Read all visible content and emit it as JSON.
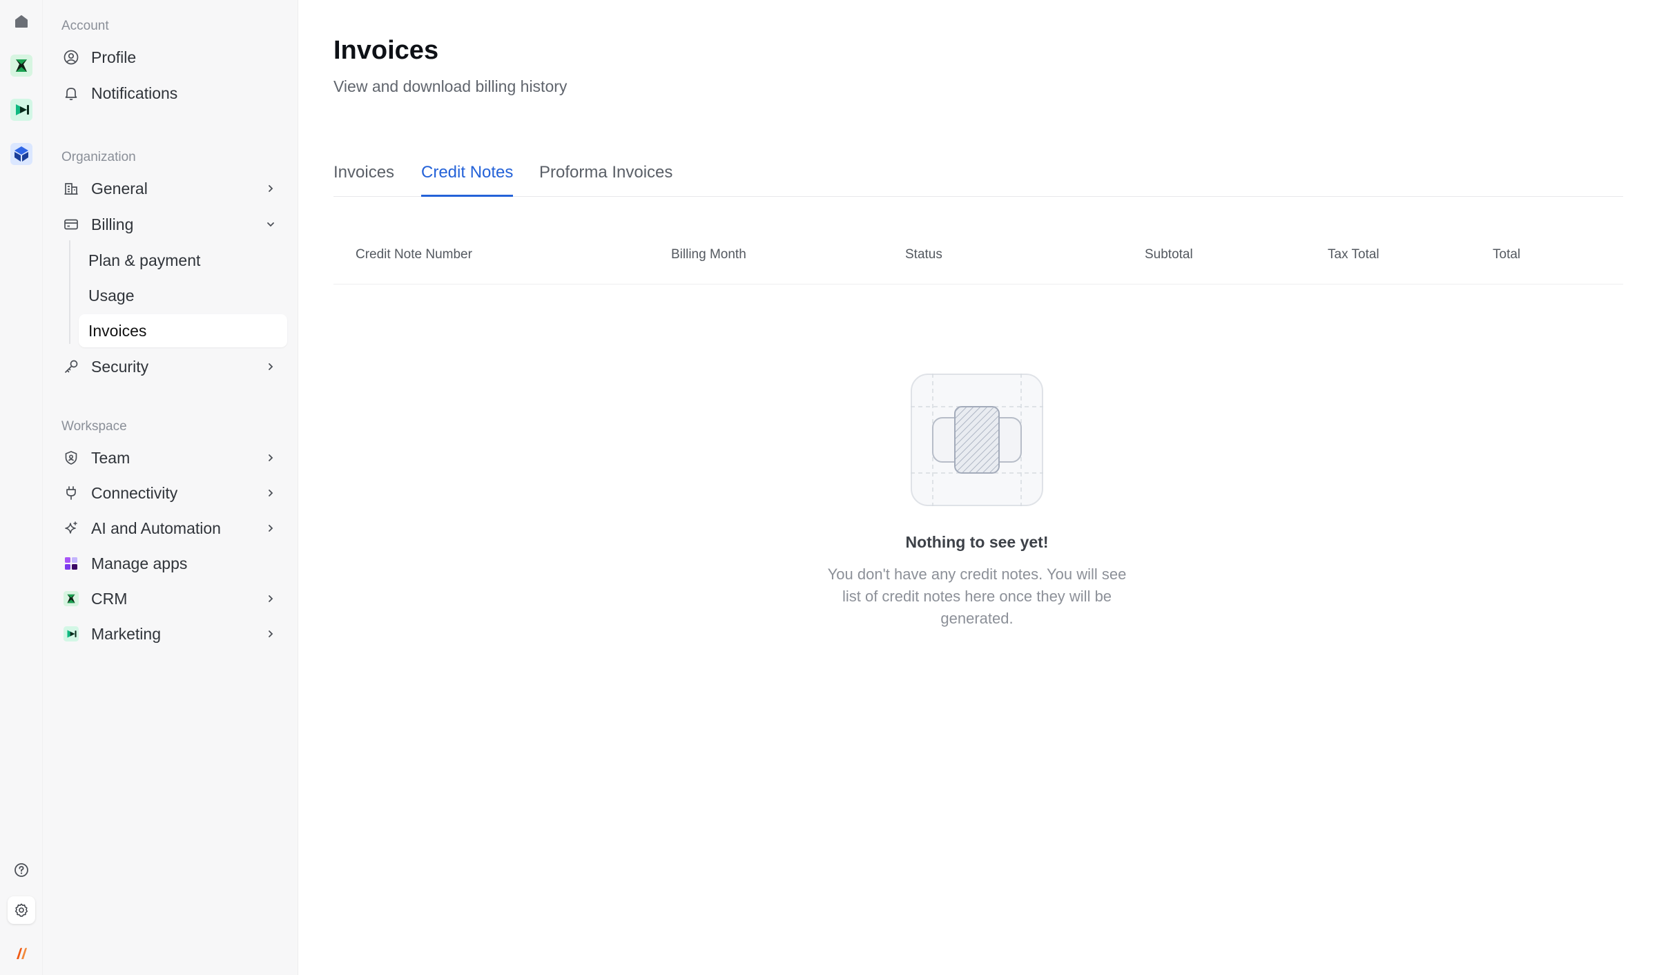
{
  "colors": {
    "accent": "#2462d8",
    "crm": "#1aa251",
    "marketing": "#10b981",
    "logo": "#f05a14"
  },
  "rail": {
    "icons": [
      "home-icon",
      "crm-app-icon",
      "marketing-app-icon",
      "workspace-app-icon",
      "help-icon",
      "settings-icon",
      "brand-logo-icon"
    ]
  },
  "sidebar": {
    "account_label": "Account",
    "profile": "Profile",
    "notifications": "Notifications",
    "organization_label": "Organization",
    "general": "General",
    "billing": "Billing",
    "plan_payment": "Plan & payment",
    "usage": "Usage",
    "invoices": "Invoices",
    "security": "Security",
    "workspace_label": "Workspace",
    "team": "Team",
    "connectivity": "Connectivity",
    "ai_automation": "AI and Automation",
    "manage_apps": "Manage apps",
    "crm": "CRM",
    "marketing": "Marketing"
  },
  "main": {
    "title": "Invoices",
    "subtitle": "View and download billing history",
    "tabs": [
      {
        "label": "Invoices"
      },
      {
        "label": "Credit Notes"
      },
      {
        "label": "Proforma Invoices"
      }
    ],
    "columns": [
      "Credit Note Number",
      "Billing Month",
      "Status",
      "Subtotal",
      "Tax Total",
      "Total"
    ],
    "empty": {
      "title": "Nothing to see yet!",
      "description": "You don't have any credit notes. You will see list of credit notes here once they will be generated."
    }
  }
}
